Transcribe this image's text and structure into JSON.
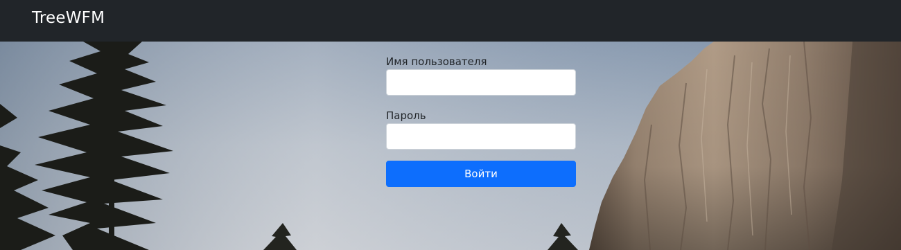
{
  "navbar": {
    "brand": "TreeWFM"
  },
  "login_form": {
    "username_label": "Имя пользователя",
    "username_value": "",
    "password_label": "Пароль",
    "password_value": "",
    "submit_label": "Войти"
  },
  "colors": {
    "navbar_bg": "#212529",
    "primary_button": "#0d6efd",
    "text_dark": "#212529"
  }
}
